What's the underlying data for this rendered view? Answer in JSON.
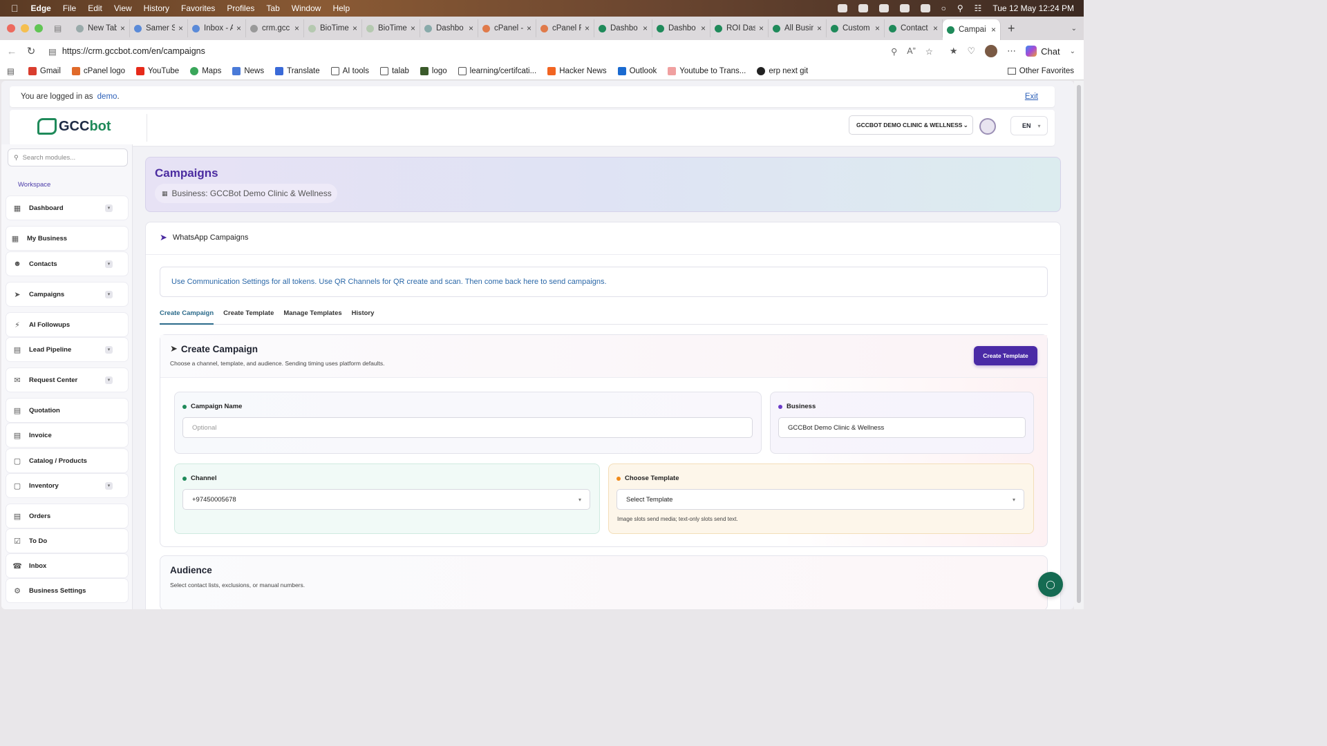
{
  "menubar": {
    "app": "Edge",
    "items": [
      "File",
      "Edit",
      "View",
      "History",
      "Favorites",
      "Profiles",
      "Tab",
      "Window",
      "Help"
    ],
    "clock": "Tue 12 May  12:24 PM"
  },
  "tabs": [
    {
      "label": "New Tab"
    },
    {
      "label": "Samer S"
    },
    {
      "label": "Inbox - A"
    },
    {
      "label": "crm.gcc"
    },
    {
      "label": "BioTime"
    },
    {
      "label": "BioTime"
    },
    {
      "label": "Dashbo"
    },
    {
      "label": "cPanel -"
    },
    {
      "label": "cPanel F"
    },
    {
      "label": "Dashbo"
    },
    {
      "label": "Dashbo"
    },
    {
      "label": "ROI Dash"
    },
    {
      "label": "All Busin"
    },
    {
      "label": "Custom"
    },
    {
      "label": "Contact"
    },
    {
      "label": "Campai",
      "active": true
    }
  ],
  "address": {
    "url": "https://crm.gccbot.com/en/campaigns",
    "chat": "Chat"
  },
  "bookmarks": [
    "Gmail",
    "cPanel logo",
    "YouTube",
    "Maps",
    "News",
    "Translate",
    "AI tools",
    "talab",
    "logo",
    "learning/certifcati...",
    "Hacker News",
    "Outlook",
    "Youtube to Trans...",
    "erp next git"
  ],
  "bookmarks_other": "Other Favorites",
  "session": {
    "prefix": "You are logged in as",
    "user": "demo",
    "suffix": ".",
    "exit": "Exit"
  },
  "header": {
    "logo_g": "G",
    "logo_text": "GCC",
    "logo_bot": "bot",
    "business_select": "GCCBOT DEMO CLINIC & WELLNESS",
    "lang": "EN"
  },
  "sidebar": {
    "search_placeholder": "Search modules...",
    "section": "Workspace",
    "items": [
      {
        "label": "Dashboard",
        "icon": "grid-icon",
        "dropdown": true
      },
      {
        "label": "My Business",
        "icon": "building-icon",
        "dropdown": false
      },
      {
        "label": "Contacts",
        "icon": "users-icon",
        "dropdown": true
      },
      {
        "label": "Campaigns",
        "icon": "send-icon",
        "dropdown": true
      },
      {
        "label": "AI Followups",
        "icon": "bolt-icon",
        "dropdown": false
      },
      {
        "label": "Lead Pipeline",
        "icon": "briefcase-icon",
        "dropdown": true
      },
      {
        "label": "Request Center",
        "icon": "inbox-icon",
        "dropdown": true
      },
      {
        "label": "Quotation",
        "icon": "file-icon",
        "dropdown": false
      },
      {
        "label": "Invoice",
        "icon": "invoice-icon",
        "dropdown": false
      },
      {
        "label": "Catalog / Products",
        "icon": "box-icon",
        "dropdown": false
      },
      {
        "label": "Inventory",
        "icon": "cube-icon",
        "dropdown": true
      },
      {
        "label": "Orders",
        "icon": "calendar-icon",
        "dropdown": false
      },
      {
        "label": "To Do",
        "icon": "checklist-icon",
        "dropdown": false
      },
      {
        "label": "Inbox",
        "icon": "whatsapp-icon",
        "dropdown": false
      },
      {
        "label": "Business Settings",
        "icon": "gear-icon",
        "dropdown": false
      }
    ]
  },
  "hero": {
    "title": "Campaigns",
    "business": "Business: GCCBot Demo Clinic & Wellness"
  },
  "card": {
    "title": "WhatsApp Campaigns",
    "info": "Use Communication Settings for all tokens. Use QR Channels for QR create and scan. Then come back here to send campaigns.",
    "tabs": [
      "Create Campaign",
      "Create Template",
      "Manage Templates",
      "History"
    ],
    "create": {
      "title": "Create Campaign",
      "subtitle": "Choose a channel, template, and audience. Sending timing uses platform defaults.",
      "button": "Create Template",
      "campaign_name_label": "Campaign Name",
      "campaign_name_placeholder": "Optional",
      "business_label": "Business",
      "business_value": "GCCBot Demo Clinic & Wellness",
      "channel_label": "Channel",
      "channel_value": "+97450005678",
      "template_label": "Choose Template",
      "template_value": "Select Template",
      "template_hint": "Image slots send media; text-only slots send text."
    },
    "audience": {
      "title": "Audience",
      "subtitle": "Select contact lists, exclusions, or manual numbers."
    }
  },
  "colors": {
    "brand": "#4a2aa6",
    "accent_green": "#156b52",
    "link": "#2b68a8"
  }
}
